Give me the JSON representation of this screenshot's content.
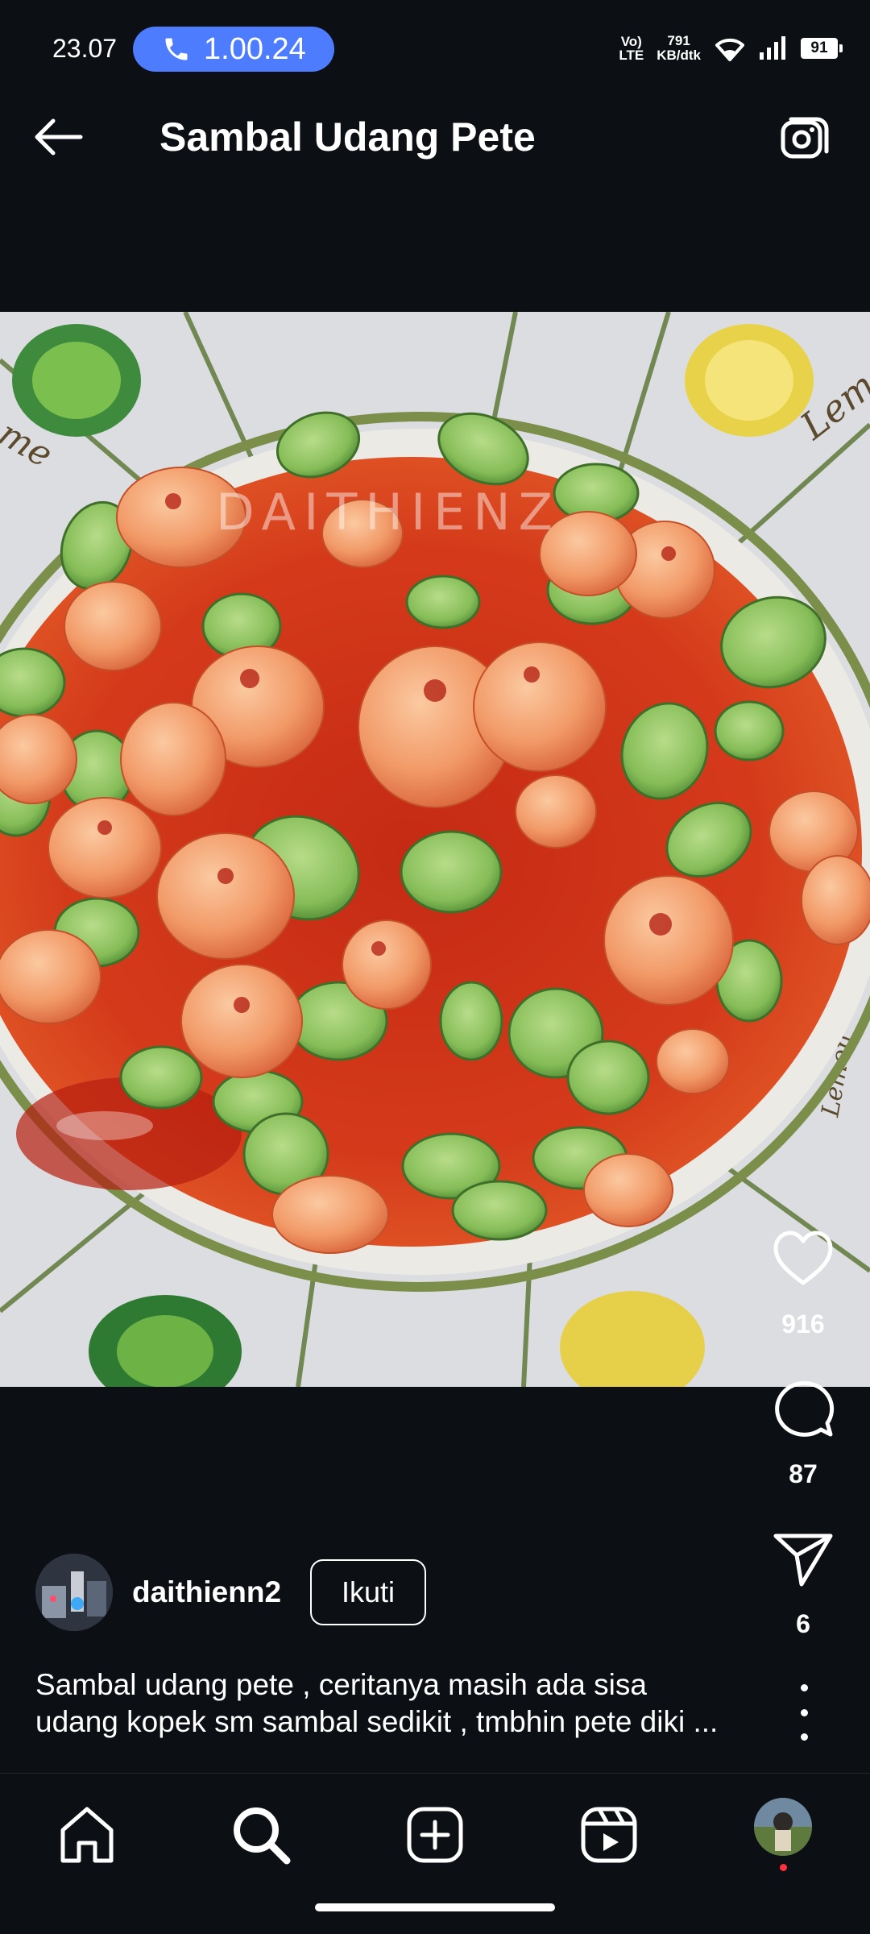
{
  "status_bar": {
    "time": "23.07",
    "call_duration": "1.00.24",
    "volte": "Vo) LTE",
    "volte_line1": "Vo)",
    "volte_line2": "LTE",
    "network_speed_value": "791",
    "network_speed_unit": "KB/dtk",
    "battery": "91",
    "call_pill_color": "#4d7cff"
  },
  "header": {
    "title": "Sambal Udang Pete",
    "back_icon": "arrow-left-icon",
    "camera_icon": "camera-icon"
  },
  "media": {
    "watermark": "DAITHIENZ",
    "plate_labels": [
      "Lemon",
      "Lemon",
      "me"
    ]
  },
  "actions": {
    "likes": "916",
    "comments": "87",
    "shares": "6"
  },
  "post": {
    "username": "daithienn2",
    "follow_label": "Ikuti",
    "caption_line1": "Sambal udang pete , ceritanya masih ada sisa",
    "caption_line2": "udang kopek sm sambal sedikit , tmbhin pete diki ..."
  },
  "bottom_nav": {
    "items": [
      "home-icon",
      "search-icon",
      "create-icon",
      "reels-icon",
      "profile-avatar"
    ]
  },
  "colors": {
    "background": "#0c0f14",
    "notification_dot": "#ff3040"
  }
}
